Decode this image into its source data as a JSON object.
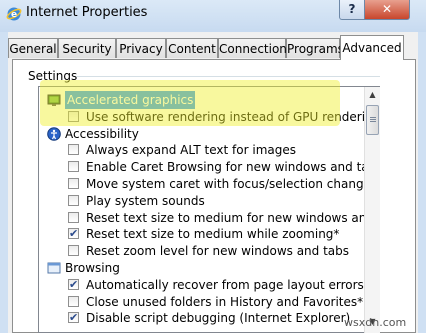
{
  "window": {
    "title": "Internet Properties",
    "help_glyph": "?",
    "close_glyph": "✕"
  },
  "tabs": [
    "General",
    "Security",
    "Privacy",
    "Content",
    "Connections",
    "Programs",
    "Advanced"
  ],
  "active_tab": "Advanced",
  "settings_label": "Settings",
  "list_items": [
    {
      "type": "category",
      "label": "Accelerated graphics",
      "icon": "monitor-icon",
      "selected": true
    },
    {
      "type": "option",
      "label": "Use software rendering instead of GPU rendering*",
      "checked": false
    },
    {
      "type": "category",
      "label": "Accessibility",
      "icon": "accessibility-icon"
    },
    {
      "type": "option",
      "label": "Always expand ALT text for images",
      "checked": false
    },
    {
      "type": "option",
      "label": "Enable Caret Browsing for new windows and tabs",
      "checked": false
    },
    {
      "type": "option",
      "label": "Move system caret with focus/selection changes",
      "checked": false
    },
    {
      "type": "option",
      "label": "Play system sounds",
      "checked": false
    },
    {
      "type": "option",
      "label": "Reset text size to medium for new windows and tabs",
      "checked": false
    },
    {
      "type": "option",
      "label": "Reset text size to medium while zooming*",
      "checked": true
    },
    {
      "type": "option",
      "label": "Reset zoom level for new windows and tabs",
      "checked": false
    },
    {
      "type": "category",
      "label": "Browsing",
      "icon": "page-icon"
    },
    {
      "type": "option",
      "label": "Automatically recover from page layout errors with Compa",
      "checked": true
    },
    {
      "type": "option",
      "label": "Close unused folders in History and Favorites*",
      "checked": false
    },
    {
      "type": "option",
      "label": "Disable script debugging (Internet Explorer)",
      "checked": true
    }
  ],
  "watermark": "wsxdn.com",
  "colors": {
    "highlight": "#f0f028",
    "selection": "#3399ff",
    "check": "#2b4b8c"
  }
}
